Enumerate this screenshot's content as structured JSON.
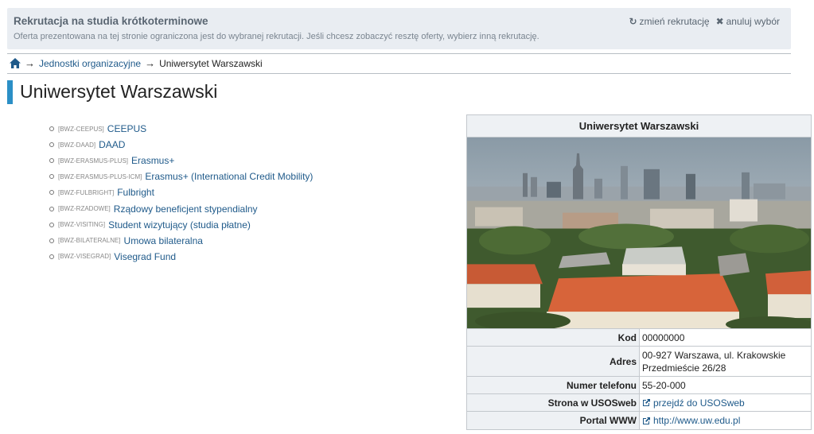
{
  "notice": {
    "title": "Rekrutacja na studia krótkoterminowe",
    "text": "Oferta prezentowana na tej stronie ograniczona jest do wybranej rekrutacji. Jeśli chcesz zobaczyć resztę oferty, wybierz inną rekrutację.",
    "change_label": "zmień rekrutację",
    "cancel_label": "anuluj wybór"
  },
  "breadcrumb": {
    "level1": "Jednostki organizacyjne",
    "current": "Uniwersytet Warszawski"
  },
  "page_title": "Uniwersytet Warszawski",
  "units": [
    {
      "code": "[BWZ-CEEPUS]",
      "name": "CEEPUS"
    },
    {
      "code": "[BWZ-DAAD]",
      "name": "DAAD"
    },
    {
      "code": "[BWZ-ERASMUS-PLUS]",
      "name": "Erasmus+"
    },
    {
      "code": "[BWZ-ERASMUS-PLUS-ICM]",
      "name": "Erasmus+ (International Credit Mobility)"
    },
    {
      "code": "[BWZ-FULBRIGHT]",
      "name": "Fulbright"
    },
    {
      "code": "[BWZ-RZADOWE]",
      "name": "Rządowy beneficjent stypendialny"
    },
    {
      "code": "[BWZ-VISITING]",
      "name": "Student wizytujący (studia płatne)"
    },
    {
      "code": "[BWZ-BILATERALNE]",
      "name": "Umowa bilateralna"
    },
    {
      "code": "[BWZ-VISEGRAD]",
      "name": "Visegrad Fund"
    }
  ],
  "info": {
    "title": "Uniwersytet Warszawski",
    "rows": {
      "kod": {
        "label": "Kod",
        "value": "00000000"
      },
      "adres": {
        "label": "Adres",
        "line1": "00-927 Warszawa, ul. Krakowskie",
        "line2": "Przedmieście 26/28"
      },
      "telefon": {
        "label": "Numer telefonu",
        "value": "55-20-000"
      },
      "usosweb": {
        "label": "Strona w USOSweb",
        "value": "przejdź do USOSweb"
      },
      "www": {
        "label": "Portal WWW",
        "value": "http://www.uw.edu.pl"
      }
    }
  },
  "colors": {
    "link": "#1f5a8a",
    "accent": "#2b8fc6",
    "notice_bg": "#e9edf2"
  }
}
